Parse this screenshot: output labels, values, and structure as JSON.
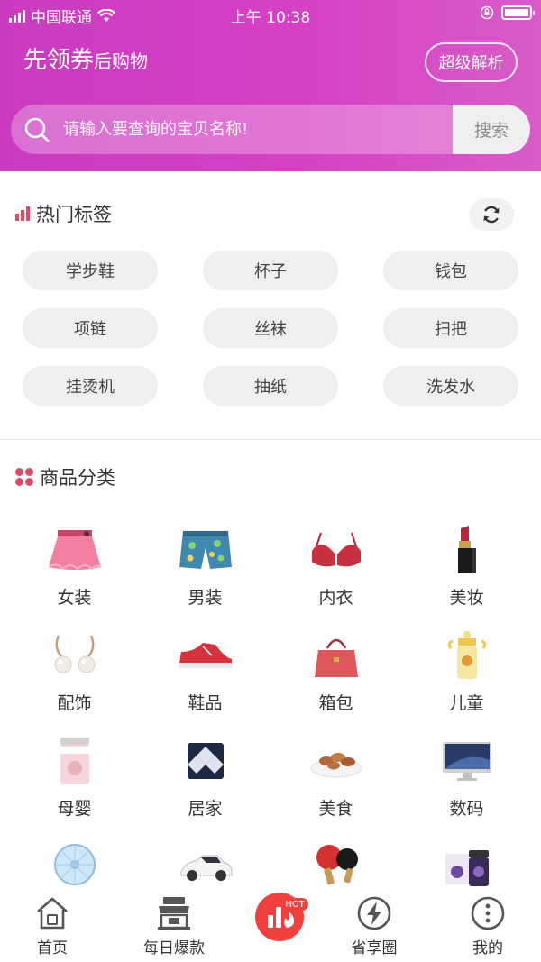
{
  "status_bar": {
    "carrier": "中国联通",
    "time": "上午 10:38"
  },
  "header": {
    "brand_main": "先领券",
    "brand_sub": "后购物",
    "parse_button": "超级解析"
  },
  "search": {
    "placeholder": "请输入要查询的宝贝名称!",
    "button": "搜索"
  },
  "hot_tags": {
    "title": "热门标签",
    "tags": [
      "学步鞋",
      "杯子",
      "钱包",
      "项链",
      "丝袜",
      "扫把",
      "挂烫机",
      "抽纸",
      "洗发水"
    ]
  },
  "categories": {
    "title": "商品分类",
    "items": [
      {
        "label": "女装",
        "icon": "skirt-icon"
      },
      {
        "label": "男装",
        "icon": "shorts-icon"
      },
      {
        "label": "内衣",
        "icon": "bra-icon"
      },
      {
        "label": "美妆",
        "icon": "lipstick-icon"
      },
      {
        "label": "配饰",
        "icon": "earrings-icon"
      },
      {
        "label": "鞋品",
        "icon": "sneaker-icon"
      },
      {
        "label": "箱包",
        "icon": "handbag-icon"
      },
      {
        "label": "儿童",
        "icon": "baby-bottle-icon"
      },
      {
        "label": "母婴",
        "icon": "formula-can-icon"
      },
      {
        "label": "居家",
        "icon": "pillow-icon"
      },
      {
        "label": "美食",
        "icon": "nuts-bowl-icon"
      },
      {
        "label": "数码",
        "icon": "monitor-icon"
      },
      {
        "label": "",
        "icon": "fan-icon"
      },
      {
        "label": "",
        "icon": "car-icon"
      },
      {
        "label": "",
        "icon": "ping-pong-icon"
      },
      {
        "label": "",
        "icon": "supplement-icon"
      }
    ]
  },
  "tab_bar": {
    "items": [
      {
        "label": "首页",
        "icon": "home-icon"
      },
      {
        "label": "每日爆款",
        "icon": "shop-icon"
      },
      {
        "label": "",
        "icon": "hot-ranking-icon"
      },
      {
        "label": "省享圈",
        "icon": "lightning-icon"
      },
      {
        "label": "我的",
        "icon": "more-icon"
      }
    ],
    "hot_badge": "HOT"
  },
  "colors": {
    "header_start": "#c93bc0",
    "header_end": "#d85cc8",
    "accent": "#e04a6a",
    "hot_red": "#f2403f"
  }
}
